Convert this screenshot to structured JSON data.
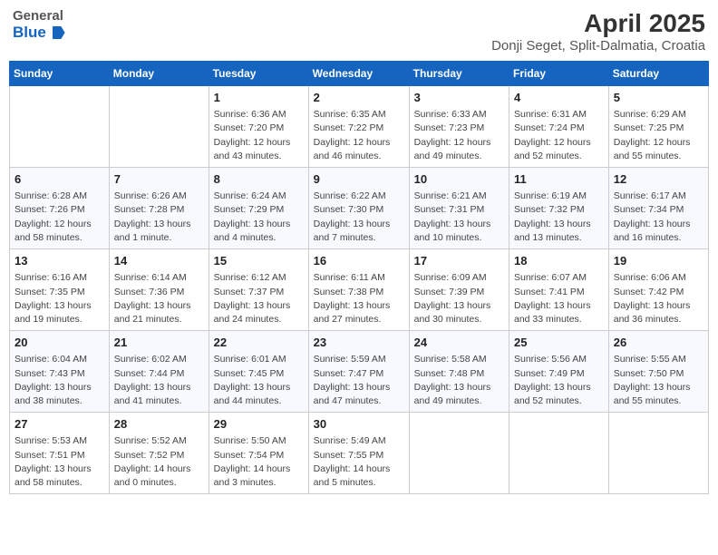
{
  "logo": {
    "general": "General",
    "blue": "Blue"
  },
  "title": "April 2025",
  "subtitle": "Donji Seget, Split-Dalmatia, Croatia",
  "headers": [
    "Sunday",
    "Monday",
    "Tuesday",
    "Wednesday",
    "Thursday",
    "Friday",
    "Saturday"
  ],
  "weeks": [
    [
      {
        "day": "",
        "info": ""
      },
      {
        "day": "",
        "info": ""
      },
      {
        "day": "1",
        "info": "Sunrise: 6:36 AM\nSunset: 7:20 PM\nDaylight: 12 hours and 43 minutes."
      },
      {
        "day": "2",
        "info": "Sunrise: 6:35 AM\nSunset: 7:22 PM\nDaylight: 12 hours and 46 minutes."
      },
      {
        "day": "3",
        "info": "Sunrise: 6:33 AM\nSunset: 7:23 PM\nDaylight: 12 hours and 49 minutes."
      },
      {
        "day": "4",
        "info": "Sunrise: 6:31 AM\nSunset: 7:24 PM\nDaylight: 12 hours and 52 minutes."
      },
      {
        "day": "5",
        "info": "Sunrise: 6:29 AM\nSunset: 7:25 PM\nDaylight: 12 hours and 55 minutes."
      }
    ],
    [
      {
        "day": "6",
        "info": "Sunrise: 6:28 AM\nSunset: 7:26 PM\nDaylight: 12 hours and 58 minutes."
      },
      {
        "day": "7",
        "info": "Sunrise: 6:26 AM\nSunset: 7:28 PM\nDaylight: 13 hours and 1 minute."
      },
      {
        "day": "8",
        "info": "Sunrise: 6:24 AM\nSunset: 7:29 PM\nDaylight: 13 hours and 4 minutes."
      },
      {
        "day": "9",
        "info": "Sunrise: 6:22 AM\nSunset: 7:30 PM\nDaylight: 13 hours and 7 minutes."
      },
      {
        "day": "10",
        "info": "Sunrise: 6:21 AM\nSunset: 7:31 PM\nDaylight: 13 hours and 10 minutes."
      },
      {
        "day": "11",
        "info": "Sunrise: 6:19 AM\nSunset: 7:32 PM\nDaylight: 13 hours and 13 minutes."
      },
      {
        "day": "12",
        "info": "Sunrise: 6:17 AM\nSunset: 7:34 PM\nDaylight: 13 hours and 16 minutes."
      }
    ],
    [
      {
        "day": "13",
        "info": "Sunrise: 6:16 AM\nSunset: 7:35 PM\nDaylight: 13 hours and 19 minutes."
      },
      {
        "day": "14",
        "info": "Sunrise: 6:14 AM\nSunset: 7:36 PM\nDaylight: 13 hours and 21 minutes."
      },
      {
        "day": "15",
        "info": "Sunrise: 6:12 AM\nSunset: 7:37 PM\nDaylight: 13 hours and 24 minutes."
      },
      {
        "day": "16",
        "info": "Sunrise: 6:11 AM\nSunset: 7:38 PM\nDaylight: 13 hours and 27 minutes."
      },
      {
        "day": "17",
        "info": "Sunrise: 6:09 AM\nSunset: 7:39 PM\nDaylight: 13 hours and 30 minutes."
      },
      {
        "day": "18",
        "info": "Sunrise: 6:07 AM\nSunset: 7:41 PM\nDaylight: 13 hours and 33 minutes."
      },
      {
        "day": "19",
        "info": "Sunrise: 6:06 AM\nSunset: 7:42 PM\nDaylight: 13 hours and 36 minutes."
      }
    ],
    [
      {
        "day": "20",
        "info": "Sunrise: 6:04 AM\nSunset: 7:43 PM\nDaylight: 13 hours and 38 minutes."
      },
      {
        "day": "21",
        "info": "Sunrise: 6:02 AM\nSunset: 7:44 PM\nDaylight: 13 hours and 41 minutes."
      },
      {
        "day": "22",
        "info": "Sunrise: 6:01 AM\nSunset: 7:45 PM\nDaylight: 13 hours and 44 minutes."
      },
      {
        "day": "23",
        "info": "Sunrise: 5:59 AM\nSunset: 7:47 PM\nDaylight: 13 hours and 47 minutes."
      },
      {
        "day": "24",
        "info": "Sunrise: 5:58 AM\nSunset: 7:48 PM\nDaylight: 13 hours and 49 minutes."
      },
      {
        "day": "25",
        "info": "Sunrise: 5:56 AM\nSunset: 7:49 PM\nDaylight: 13 hours and 52 minutes."
      },
      {
        "day": "26",
        "info": "Sunrise: 5:55 AM\nSunset: 7:50 PM\nDaylight: 13 hours and 55 minutes."
      }
    ],
    [
      {
        "day": "27",
        "info": "Sunrise: 5:53 AM\nSunset: 7:51 PM\nDaylight: 13 hours and 58 minutes."
      },
      {
        "day": "28",
        "info": "Sunrise: 5:52 AM\nSunset: 7:52 PM\nDaylight: 14 hours and 0 minutes."
      },
      {
        "day": "29",
        "info": "Sunrise: 5:50 AM\nSunset: 7:54 PM\nDaylight: 14 hours and 3 minutes."
      },
      {
        "day": "30",
        "info": "Sunrise: 5:49 AM\nSunset: 7:55 PM\nDaylight: 14 hours and 5 minutes."
      },
      {
        "day": "",
        "info": ""
      },
      {
        "day": "",
        "info": ""
      },
      {
        "day": "",
        "info": ""
      }
    ]
  ]
}
